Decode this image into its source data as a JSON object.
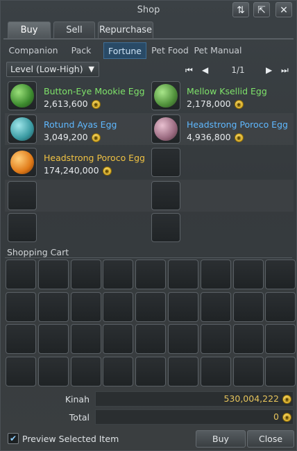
{
  "window": {
    "title": "Shop"
  },
  "title_buttons": [
    {
      "name": "refresh",
      "glyph": "⇅"
    },
    {
      "name": "collapse",
      "glyph": "⇱"
    },
    {
      "name": "close",
      "glyph": "✕"
    }
  ],
  "main_tabs": [
    {
      "label": "Buy",
      "active": true
    },
    {
      "label": "Sell",
      "active": false
    },
    {
      "label": "Repurchase",
      "active": false
    }
  ],
  "sub_tabs": [
    {
      "label": "Companion",
      "active": false
    },
    {
      "label": "Pack",
      "active": false
    },
    {
      "label": "Fortune",
      "active": true
    },
    {
      "label": "Pet Food",
      "active": false
    },
    {
      "label": "Pet Manual",
      "active": false
    }
  ],
  "sort": {
    "selected": "Level (Low-High)"
  },
  "pager": {
    "first": "⏮",
    "prev": "◀",
    "page": "1/1",
    "next": "▶",
    "last": "⏭"
  },
  "items": [
    {
      "name": "Button-Eye Mookie Egg",
      "price": "2,613,600",
      "name_color": "#7fe36a",
      "egg": "green"
    },
    {
      "name": "Mellow Ksellid Egg",
      "price": "2,178,000",
      "name_color": "#7fe36a",
      "egg": "green"
    },
    {
      "name": "Rotund Ayas Egg",
      "price": "3,049,200",
      "name_color": "#5fb8ff",
      "egg": "teal"
    },
    {
      "name": "Headstrong Poroco Egg",
      "price": "4,936,800",
      "name_color": "#5fb8ff",
      "egg": "pink"
    },
    {
      "name": "Headstrong Poroco Egg",
      "price": "174,240,000",
      "name_color": "#f0c243",
      "egg": "orange"
    }
  ],
  "cart": {
    "label": "Shopping Cart"
  },
  "totals": {
    "kinah_label": "Kinah",
    "kinah_value": "530,004,222",
    "total_label": "Total",
    "total_value": "0"
  },
  "footer": {
    "preview_label": "Preview Selected Item",
    "preview_checked": true,
    "buy_label": "Buy",
    "close_label": "Close"
  }
}
